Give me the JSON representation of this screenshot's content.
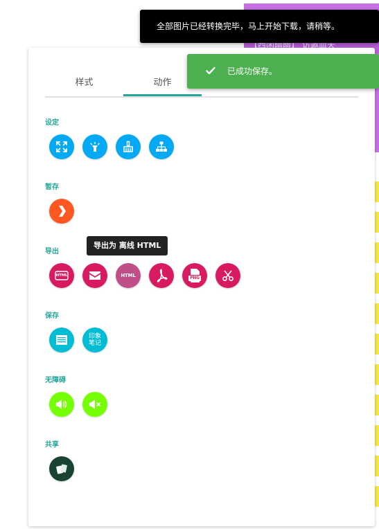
{
  "background": {
    "strip_text": "【西闲暗暗】    访邀血天"
  },
  "tabs": [
    {
      "label": "样式"
    },
    {
      "label": "动作"
    }
  ],
  "sections": {
    "settings": {
      "label": "设定"
    },
    "temp": {
      "label": "暂存"
    },
    "export": {
      "label": "导出",
      "html_label": "HTML",
      "html2_label": "HTML",
      "png_label": "PNG"
    },
    "save": {
      "label": "保存",
      "evernote_label_1": "印象",
      "evernote_label_2": "笔记"
    },
    "accessibility": {
      "label": "无障碍"
    },
    "share": {
      "label": "共享"
    }
  },
  "tooltip": {
    "text": "导出为 离线 HTML"
  },
  "toasts": {
    "download": "全部图片已经转换完毕，马上开始下载，请稍等。",
    "saved": "已成功保存。"
  },
  "colors": {
    "accent": "#26a69a",
    "settings_btn": "#03a9f4",
    "temp_btn": "#ff5722",
    "export_btn": "#d81b60",
    "save_btn": "#00bcd4",
    "accessibility_btn": "#76ff03",
    "share_btn": "#1b4332",
    "toast_success": "#4caf50"
  },
  "icons": {
    "settings": [
      "fullscreen-icon",
      "flashlight-icon",
      "broom-icon",
      "sitemap-icon"
    ],
    "temp": [
      "pocket-icon"
    ],
    "export": [
      "html-file-icon",
      "email-icon",
      "offline-html-icon",
      "pdf-icon",
      "png-icon",
      "scissors-icon"
    ],
    "save": [
      "page-save-icon",
      "evernote-icon"
    ],
    "accessibility": [
      "speaker-on-icon",
      "speaker-mute-icon"
    ],
    "share": [
      "cards-share-icon"
    ]
  }
}
